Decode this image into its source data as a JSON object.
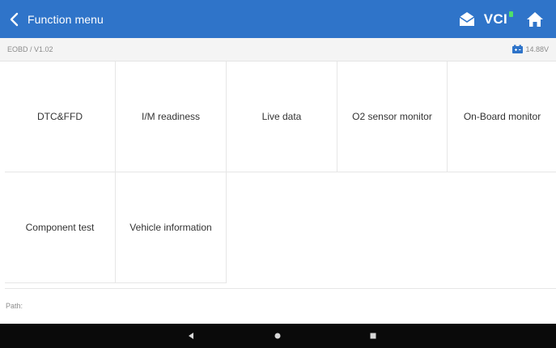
{
  "header": {
    "title": "Function menu",
    "vci_label": "VCI"
  },
  "subheader": {
    "breadcrumb": "EOBD / V1.02",
    "voltage": "14.88V"
  },
  "functions": [
    {
      "label": "DTC&FFD"
    },
    {
      "label": "I/M readiness"
    },
    {
      "label": "Live data"
    },
    {
      "label": "O2 sensor monitor"
    },
    {
      "label": "On-Board monitor"
    },
    {
      "label": "Component test"
    },
    {
      "label": "Vehicle information"
    }
  ],
  "footer": {
    "path_label": "Path:"
  },
  "colors": {
    "titlebar": "#2f74c9",
    "vci_indicator": "#4fe06a",
    "battery": "#2f74c9",
    "navbar": "#0a0a0a"
  }
}
